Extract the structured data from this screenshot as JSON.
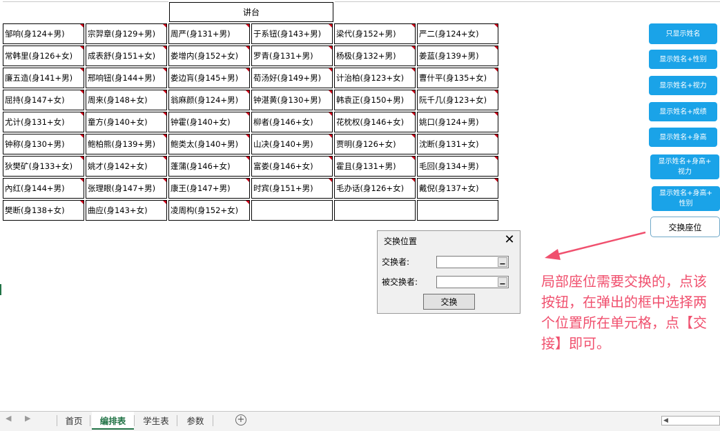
{
  "stage_label": "讲台",
  "seats": [
    [
      "邹响(身124+男)",
      "宗羿章(身129+男)",
      "周严(身131+男)",
      "于系钮(身143+男)",
      "梁代(身152+男)",
      "严二(身124+女)"
    ],
    [
      "常韩里(身126+女)",
      "成表舒(身151+女)",
      "娄增内(身152+女)",
      "罗青(身131+男)",
      "杨极(身132+男)",
      "姜蓝(身139+男)"
    ],
    [
      "廉五造(身141+男)",
      "邢响钮(身144+男)",
      "娄边肓(身145+男)",
      "荀汤好(身149+男)",
      "计治柏(身123+女)",
      "曹什平(身135+女)"
    ],
    [
      "屈持(身147+女)",
      "周来(身148+女)",
      "翁麻颜(身124+男)",
      "钟湛黄(身130+男)",
      "韩袁正(身150+男)",
      "阮千几(身123+女)"
    ],
    [
      "尤计(身131+女)",
      "童方(身140+女)",
      "钟霍(身140+女)",
      "柳者(身146+女)",
      "花枕权(身146+女)",
      "姚口(身124+男)"
    ],
    [
      "钟称(身130+男)",
      "鲍柏熊(身139+男)",
      "鲍类太(身140+男)",
      "山决(身140+男)",
      "贾明(身126+女)",
      "沈断(身131+女)"
    ],
    [
      "狄樊矿(身133+女)",
      "姚才(身142+女)",
      "蓬蒲(身146+女)",
      "富娄(身146+女)",
      "霍且(身131+男)",
      "毛回(身134+男)"
    ],
    [
      "內红(身144+男)",
      "张理眼(身147+男)",
      "康王(身147+男)",
      "时宾(身151+男)",
      "毛办话(身126+女)",
      "戴倪(身137+女)"
    ],
    [
      "樊断(身138+女)",
      "曲应(身143+女)",
      "凌周构(身152+女)",
      "",
      "",
      ""
    ]
  ],
  "side_buttons": [
    "只显示姓名",
    "显示姓名+性别",
    "显示姓名+视力",
    "显示姓名+成绩",
    "显示姓名+身高",
    "显示姓名+身高+\n视力",
    "显示姓名+身高+\n性别"
  ],
  "swap_button": "交换座位",
  "dialog": {
    "title": "交换位置",
    "close": "✕",
    "swapper_label": "交换者:",
    "swappee_label": "被交换者:",
    "swapper_value": "",
    "swappee_value": "",
    "confirm": "交换"
  },
  "annotation": "局部座位需要交换的，点该按钮，在弹出的框中选择两个位置所在单元格，点【交接】即可。",
  "sheet_tabs": [
    "首页",
    "编排表",
    "学生表",
    "参数"
  ],
  "active_tab_index": 1,
  "colors": {
    "accent_button": "#1aa3e8",
    "annotation": "#f0506e",
    "active_tab": "#217346"
  }
}
